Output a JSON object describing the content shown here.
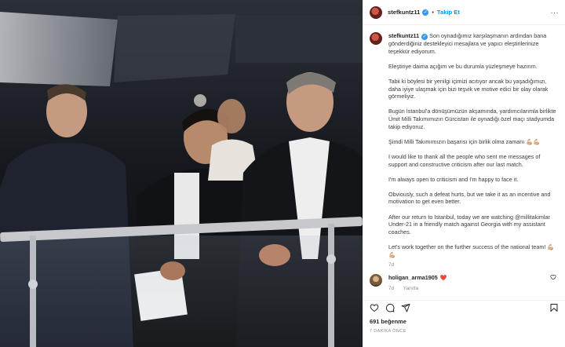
{
  "post": {
    "username": "stefkuntz11",
    "follow_label": "Takip Et",
    "more_label": "···",
    "caption": {
      "username": "stefkuntz11",
      "p1": "Son oynadığımız karşılaşmanın ardından bana gönderdiğiniz destekleyici mesajlara ve yapıcı eleştirilerinize teşekkür ediyorum.",
      "p2": "Eleştiriye daima açığım ve bu durumla yüzleşmeye hazırım.",
      "p3": "Tabii ki böylesi bir yenilgi içimizi acıtıyor ancak bu yaşadığımızı, daha iyiye ulaşmak için bizi teşvik ve motive edici bir olay olarak görmeliyiz.",
      "p4": "Bugün İstanbul'a dönüşümüzün akşamında, yardımcılarımla birlikte Ümit Milli Takımımızın Gürcistan ile oynadığı özel maçı stadyumda takip ediyoruz.",
      "p5": "Şimdi Milli Takımımızın başarısı için birlik olma zamanı 💪🏼💪🏼",
      "p6": "I would like to thank all the people who sent me messages of support and constructive criticism after our last match.",
      "p7": "I'm always open to criticism and I'm happy to face it.",
      "p8": "Obviously, such a defeat hurts, but we take it as an incentive and motivation to get even better.",
      "p9": "After our return to Istanbul, today we are watching @millitakimlar Under-21 in a friendly match against Georgia with my assistant coaches.",
      "p10": "Let's work together on the further success of the national team! 💪🏼💪🏼",
      "age": "7d"
    },
    "comment": {
      "username": "holigan_arma1905",
      "emoji": "❤️",
      "age": "7d",
      "reply_label": "Yanıtla"
    },
    "likes": "691 beğenme",
    "date": "7 DAKİKA ÖNCE",
    "icons": [
      "heart-icon",
      "comment-icon",
      "share-icon",
      "bookmark-icon"
    ]
  }
}
